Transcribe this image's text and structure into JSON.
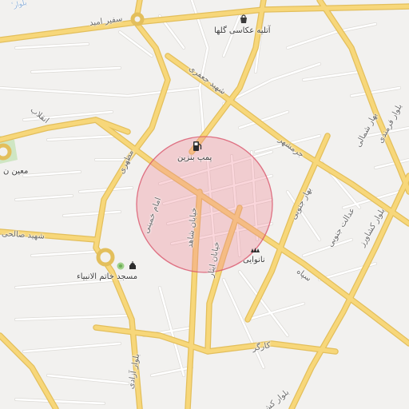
{
  "map": {
    "colors": {
      "background": "#f2f1ef",
      "major_road": "#f7d77a",
      "major_road_edge": "#e3bf5c",
      "minor_road": "#ffffff",
      "minor_road_edge": "#dcdad6",
      "radius_fill": "#f08a98",
      "radius_stroke": "#d9546a",
      "park": "#cfe6c3",
      "water_text": "#8fb1d9"
    },
    "labels": {
      "safir_amid": "سفیر امید",
      "atelier": "آتلیه عکاسی گلها",
      "shahid_jafari": "شهید جعفری",
      "enghelab": "انقلاب",
      "moin_partial": "معین ن",
      "motahari": "مطهری",
      "pump_benzin": "پمپ بنزین",
      "jaranshahr": "جرمشهر",
      "bahar_shomali": "بهار شمالی",
      "bolvar_farmandi": "بلوار فرمندی",
      "bahar_jonubi": "بهار جنوبی",
      "edalat_jonubi": "عدالت جنوبی",
      "bolvar_keshavarz": "بلوار کشاورز",
      "imam_khomeini": "امام خمینی",
      "khiaban_shahed": "خیابان شاهد",
      "shahid_salehi": "شهید صالحی",
      "khiaban_isar": "خیابان ایثار",
      "nanvaei": "نانوایی",
      "sepah": "سپاه",
      "masjed": "مسجد خاتم الانبیاء",
      "kargar": "کارگر",
      "bolvar_azadi": "بلوار آزادی",
      "bolvar_ke": "بلوار کش",
      "top_left_water": "ٔ بلوار"
    },
    "icons": {
      "shop": "shopping-bag-icon",
      "fuel": "fuel-pump-icon",
      "bakery": "bakery-icon",
      "mosque": "mosque-icon",
      "park": "park-icon"
    }
  }
}
